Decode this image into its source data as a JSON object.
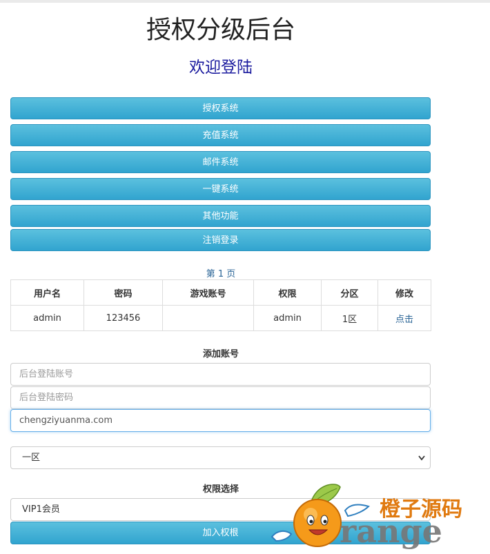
{
  "header": {
    "title": "授权分级后台",
    "subtitle": "欢迎登陆"
  },
  "menu": {
    "items": [
      {
        "label": "授权系统"
      },
      {
        "label": "充值系统"
      },
      {
        "label": "邮件系统"
      },
      {
        "label": "一键系统"
      },
      {
        "label": "其他功能"
      },
      {
        "label": "注销登录"
      }
    ]
  },
  "pagination": {
    "label": "第 1 页"
  },
  "table": {
    "headers": [
      "用户名",
      "密码",
      "游戏账号",
      "权限",
      "分区",
      "修改"
    ],
    "rows": [
      [
        "admin",
        "123456",
        "",
        "admin",
        "1区",
        "点击"
      ]
    ]
  },
  "add_account": {
    "title": "添加账号",
    "username_placeholder": "后台登陆账号",
    "password_placeholder": "后台登陆密码",
    "game_account_value": "chengziyuanma.com",
    "zone_selected": "一区"
  },
  "permission": {
    "title": "权限选择",
    "selected": "VIP1会员",
    "submit_label": "加入权根"
  },
  "watermark": {
    "text_cn": "橙子源码",
    "text_en": "range"
  },
  "colors": {
    "button_blue": "#31a4cf",
    "link_blue": "#2a6496",
    "subtitle_blue": "#1a1a9e"
  }
}
